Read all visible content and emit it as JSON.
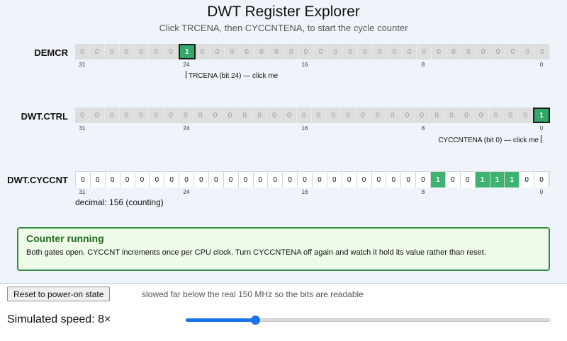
{
  "header": {
    "title": "DWT Register Explorer",
    "subtitle": "Click TRCENA, then CYCCNTENA, to start the cycle counter"
  },
  "tick_labels": [
    "31",
    "24",
    "16",
    "8",
    "0"
  ],
  "registers": {
    "demcr": {
      "label": "DEMCR",
      "bits": [
        "0",
        "0",
        "0",
        "0",
        "0",
        "0",
        "0",
        "1",
        "0",
        "0",
        "0",
        "0",
        "0",
        "0",
        "0",
        "0",
        "0",
        "0",
        "0",
        "0",
        "0",
        "0",
        "0",
        "0",
        "0",
        "0",
        "0",
        "0",
        "0",
        "0",
        "0",
        "0"
      ],
      "callout": "TRCENA (bit 24) — click me"
    },
    "dwt_ctrl": {
      "label": "DWT.CTRL",
      "bits": [
        "0",
        "0",
        "0",
        "0",
        "0",
        "0",
        "0",
        "0",
        "0",
        "0",
        "0",
        "0",
        "0",
        "0",
        "0",
        "0",
        "0",
        "0",
        "0",
        "0",
        "0",
        "0",
        "0",
        "0",
        "0",
        "0",
        "0",
        "0",
        "0",
        "0",
        "0",
        "1"
      ],
      "callout": "CYCCNTENA (bit 0) — click me"
    },
    "dwt_cyccnt": {
      "label": "DWT.CYCCNT",
      "bits": [
        "0",
        "0",
        "0",
        "0",
        "0",
        "0",
        "0",
        "0",
        "0",
        "0",
        "0",
        "0",
        "0",
        "0",
        "0",
        "0",
        "0",
        "0",
        "0",
        "0",
        "0",
        "0",
        "0",
        "0",
        "1",
        "0",
        "0",
        "1",
        "1",
        "1",
        "0",
        "0"
      ],
      "decimal": "decimal: 156  (counting)"
    }
  },
  "status": {
    "title": "Counter running",
    "body": "Both gates open. CYCCNT increments once per CPU clock. Turn CYCCNTENA off again and watch it hold its value rather than reset."
  },
  "controls": {
    "reset_label": "Reset to power-on state",
    "note": "slowed far below the real 150 MHz so the bits are readable",
    "speed_label": "Simulated speed: 8×",
    "speed_fraction": 0.19
  },
  "colors": {
    "bit_on": "#33a86a",
    "status_border": "#2e8b3e",
    "status_title": "#1d6a1d",
    "slider": "#1a73e8"
  }
}
